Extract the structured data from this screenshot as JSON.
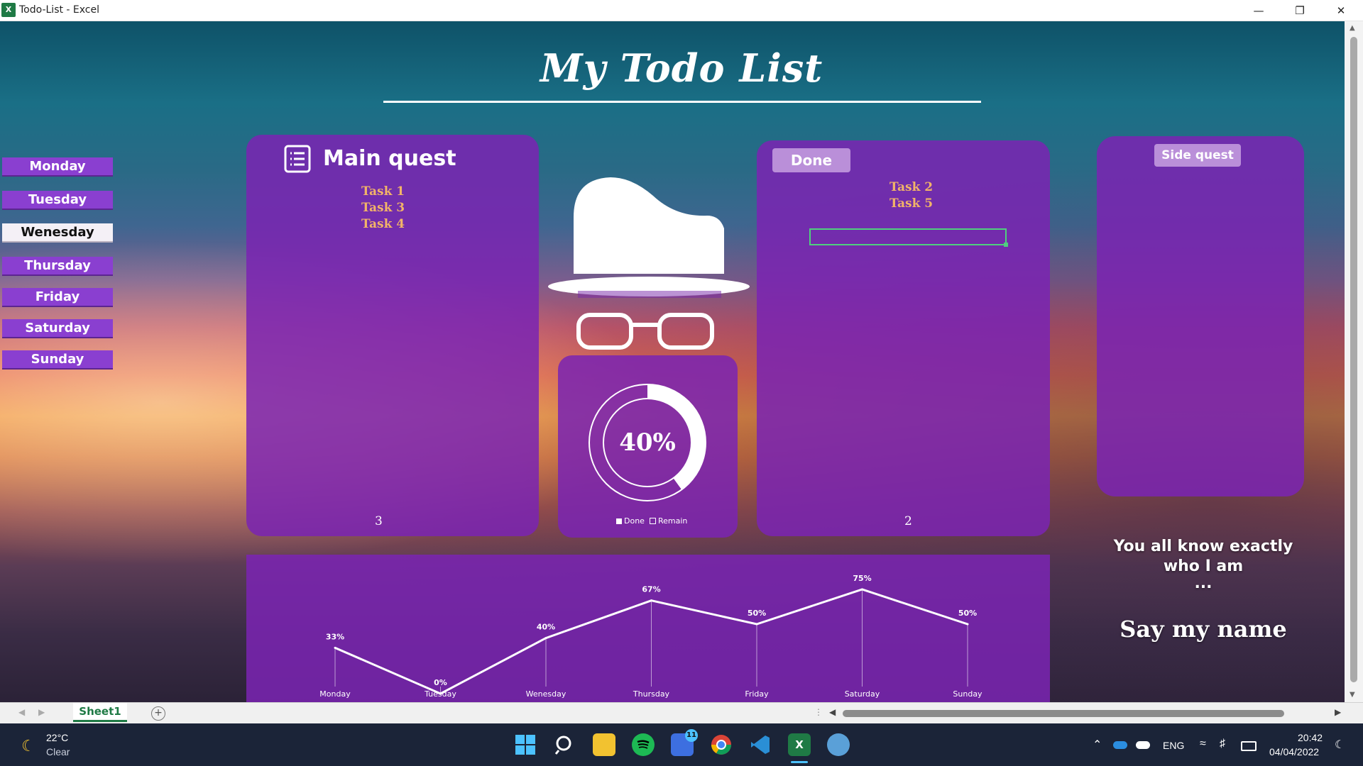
{
  "window": {
    "title": "Todo-List - Excel",
    "app_icon": "X"
  },
  "dashboard": {
    "title": "My Todo List",
    "days": [
      "Monday",
      "Tuesday",
      "Wenesday",
      "Thursday",
      "Friday",
      "Saturday",
      "Sunday"
    ],
    "active_day": "Wenesday",
    "main_quest": {
      "title": "Main quest",
      "tasks": [
        "Task 1",
        "Task 3",
        "Task 4"
      ],
      "count": "3"
    },
    "done": {
      "title": "Done",
      "tasks": [
        "Task 2",
        "Task 5"
      ],
      "count": "2"
    },
    "side_quest": {
      "title": "Side quest"
    },
    "progress": {
      "value": 40,
      "label": "40%",
      "legend_done": "Done",
      "legend_remain": "Remain"
    },
    "quote": {
      "line1": "You all know exactly",
      "line2": "who I am",
      "line3": "...",
      "line4": "Say my name"
    }
  },
  "chart_data": {
    "type": "line",
    "categories": [
      "Monday",
      "Tuesday",
      "Wenesday",
      "Thursday",
      "Friday",
      "Saturday",
      "Sunday"
    ],
    "values": [
      33,
      0,
      40,
      67,
      50,
      75,
      50
    ],
    "data_labels": [
      "33%",
      "0%",
      "40%",
      "67%",
      "50%",
      "75%",
      "50%"
    ],
    "ylim": [
      0,
      100
    ],
    "grid": false
  },
  "sheet": {
    "tab": "Sheet1"
  },
  "taskbar": {
    "weather_temp": "22°C",
    "weather_desc": "Clear",
    "language": "ENG",
    "time": "20:42",
    "date": "04/04/2022",
    "teams_badge": "11"
  },
  "colors": {
    "panel": "#7a24b2",
    "task_text": "#f2b468",
    "day_button": "#8a3fd0",
    "excel_green": "#1f7a45"
  }
}
